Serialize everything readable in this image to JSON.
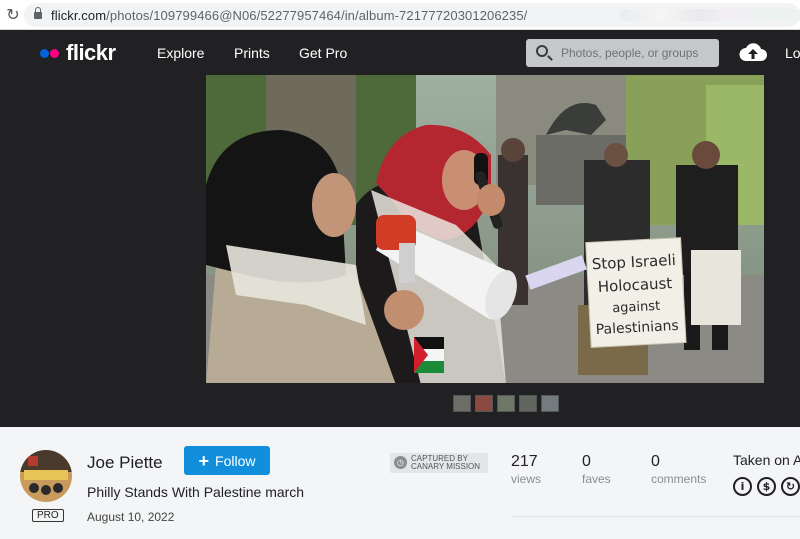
{
  "browser": {
    "url_domain": "flickr.com",
    "url_path": "/photos/109799466@N06/52277957464/in/album-72177720301206235/",
    "reload_icon": "reload-icon"
  },
  "nav": {
    "logo_text": "flickr",
    "links": [
      "Explore",
      "Prints",
      "Get Pro"
    ],
    "search_placeholder": "Photos, people, or groups",
    "login_label": "Lo"
  },
  "photo": {
    "sign_text": [
      "Stop Israeli",
      "Holocaust",
      "against",
      "Palestinians"
    ],
    "thumbnail_count": 5
  },
  "info": {
    "author": "Joe Piette",
    "pro_badge": "PRO",
    "follow_label": "Follow",
    "title": "Philly Stands With Palestine march",
    "date": "August 10, 2022",
    "captured_line1": "CAPTURED BY",
    "captured_line2": "CANARY MISSION",
    "stats": [
      {
        "value": "217",
        "label": "views"
      },
      {
        "value": "0",
        "label": "faves"
      },
      {
        "value": "0",
        "label": "comments"
      }
    ],
    "taken_on": "Taken on A"
  },
  "colors": {
    "nav_bg": "#212124",
    "flickr_blue": "#0063dc",
    "flickr_pink": "#ff0084",
    "follow_button": "#128fdc"
  }
}
